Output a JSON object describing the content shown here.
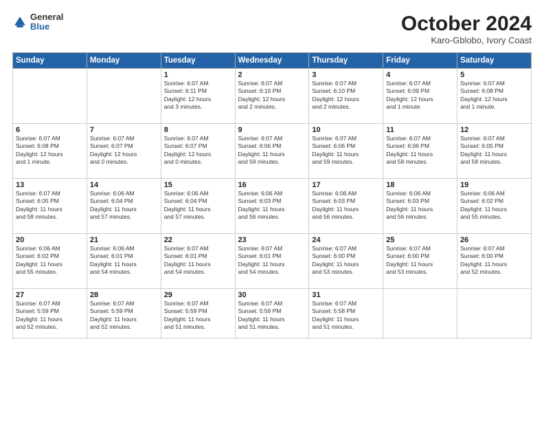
{
  "logo": {
    "general": "General",
    "blue": "Blue"
  },
  "title": "October 2024",
  "subtitle": "Karo-Gblobo, Ivory Coast",
  "days_of_week": [
    "Sunday",
    "Monday",
    "Tuesday",
    "Wednesday",
    "Thursday",
    "Friday",
    "Saturday"
  ],
  "weeks": [
    [
      {
        "num": "",
        "info": ""
      },
      {
        "num": "",
        "info": ""
      },
      {
        "num": "1",
        "info": "Sunrise: 6:07 AM\nSunset: 6:11 PM\nDaylight: 12 hours\nand 3 minutes."
      },
      {
        "num": "2",
        "info": "Sunrise: 6:07 AM\nSunset: 6:10 PM\nDaylight: 12 hours\nand 2 minutes."
      },
      {
        "num": "3",
        "info": "Sunrise: 6:07 AM\nSunset: 6:10 PM\nDaylight: 12 hours\nand 2 minutes."
      },
      {
        "num": "4",
        "info": "Sunrise: 6:07 AM\nSunset: 6:09 PM\nDaylight: 12 hours\nand 1 minute."
      },
      {
        "num": "5",
        "info": "Sunrise: 6:07 AM\nSunset: 6:08 PM\nDaylight: 12 hours\nand 1 minute."
      }
    ],
    [
      {
        "num": "6",
        "info": "Sunrise: 6:07 AM\nSunset: 6:08 PM\nDaylight: 12 hours\nand 1 minute."
      },
      {
        "num": "7",
        "info": "Sunrise: 6:07 AM\nSunset: 6:07 PM\nDaylight: 12 hours\nand 0 minutes."
      },
      {
        "num": "8",
        "info": "Sunrise: 6:07 AM\nSunset: 6:07 PM\nDaylight: 12 hours\nand 0 minutes."
      },
      {
        "num": "9",
        "info": "Sunrise: 6:07 AM\nSunset: 6:06 PM\nDaylight: 11 hours\nand 59 minutes."
      },
      {
        "num": "10",
        "info": "Sunrise: 6:07 AM\nSunset: 6:06 PM\nDaylight: 11 hours\nand 59 minutes."
      },
      {
        "num": "11",
        "info": "Sunrise: 6:07 AM\nSunset: 6:06 PM\nDaylight: 11 hours\nand 58 minutes."
      },
      {
        "num": "12",
        "info": "Sunrise: 6:07 AM\nSunset: 6:05 PM\nDaylight: 11 hours\nand 58 minutes."
      }
    ],
    [
      {
        "num": "13",
        "info": "Sunrise: 6:07 AM\nSunset: 6:05 PM\nDaylight: 11 hours\nand 58 minutes."
      },
      {
        "num": "14",
        "info": "Sunrise: 6:06 AM\nSunset: 6:04 PM\nDaylight: 11 hours\nand 57 minutes."
      },
      {
        "num": "15",
        "info": "Sunrise: 6:06 AM\nSunset: 6:04 PM\nDaylight: 11 hours\nand 57 minutes."
      },
      {
        "num": "16",
        "info": "Sunrise: 6:06 AM\nSunset: 6:03 PM\nDaylight: 11 hours\nand 56 minutes."
      },
      {
        "num": "17",
        "info": "Sunrise: 6:06 AM\nSunset: 6:03 PM\nDaylight: 11 hours\nand 56 minutes."
      },
      {
        "num": "18",
        "info": "Sunrise: 6:06 AM\nSunset: 6:03 PM\nDaylight: 11 hours\nand 56 minutes."
      },
      {
        "num": "19",
        "info": "Sunrise: 6:06 AM\nSunset: 6:02 PM\nDaylight: 11 hours\nand 55 minutes."
      }
    ],
    [
      {
        "num": "20",
        "info": "Sunrise: 6:06 AM\nSunset: 6:02 PM\nDaylight: 11 hours\nand 55 minutes."
      },
      {
        "num": "21",
        "info": "Sunrise: 6:06 AM\nSunset: 6:01 PM\nDaylight: 11 hours\nand 54 minutes."
      },
      {
        "num": "22",
        "info": "Sunrise: 6:07 AM\nSunset: 6:01 PM\nDaylight: 11 hours\nand 54 minutes."
      },
      {
        "num": "23",
        "info": "Sunrise: 6:07 AM\nSunset: 6:01 PM\nDaylight: 11 hours\nand 54 minutes."
      },
      {
        "num": "24",
        "info": "Sunrise: 6:07 AM\nSunset: 6:00 PM\nDaylight: 11 hours\nand 53 minutes."
      },
      {
        "num": "25",
        "info": "Sunrise: 6:07 AM\nSunset: 6:00 PM\nDaylight: 11 hours\nand 53 minutes."
      },
      {
        "num": "26",
        "info": "Sunrise: 6:07 AM\nSunset: 6:00 PM\nDaylight: 11 hours\nand 52 minutes."
      }
    ],
    [
      {
        "num": "27",
        "info": "Sunrise: 6:07 AM\nSunset: 5:59 PM\nDaylight: 11 hours\nand 52 minutes."
      },
      {
        "num": "28",
        "info": "Sunrise: 6:07 AM\nSunset: 5:59 PM\nDaylight: 11 hours\nand 52 minutes."
      },
      {
        "num": "29",
        "info": "Sunrise: 6:07 AM\nSunset: 5:59 PM\nDaylight: 11 hours\nand 51 minutes."
      },
      {
        "num": "30",
        "info": "Sunrise: 6:07 AM\nSunset: 5:59 PM\nDaylight: 11 hours\nand 51 minutes."
      },
      {
        "num": "31",
        "info": "Sunrise: 6:07 AM\nSunset: 5:58 PM\nDaylight: 11 hours\nand 51 minutes."
      },
      {
        "num": "",
        "info": ""
      },
      {
        "num": "",
        "info": ""
      }
    ]
  ]
}
